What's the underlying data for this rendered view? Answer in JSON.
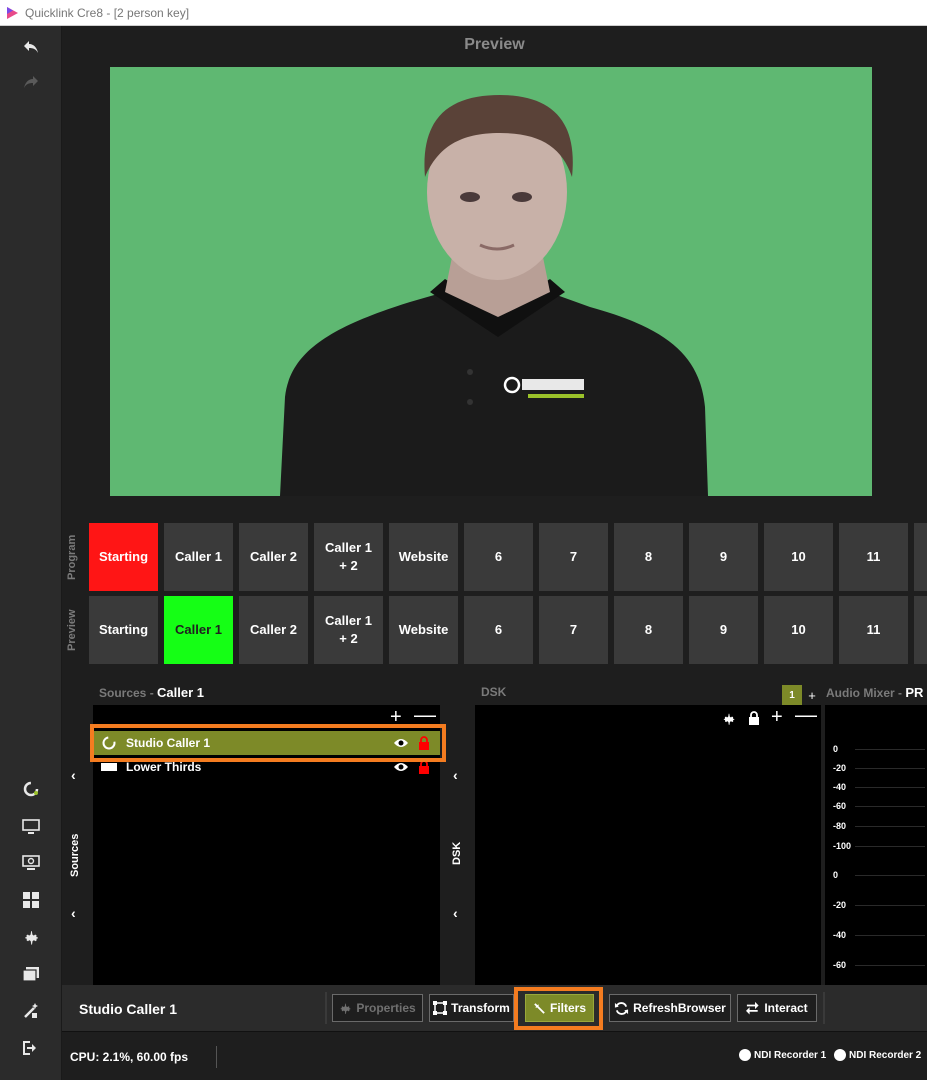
{
  "window": {
    "title": "Quicklink Cre8  - [2 person key]"
  },
  "leftbar": {
    "top_icons": [
      "undo-icon",
      "redo-icon"
    ],
    "bottom_icons": [
      "quicklink-logo-icon",
      "monitor-icon",
      "screen-share-icon",
      "layout-grid-icon",
      "gear-icon",
      "files-icon",
      "magic-tools-icon",
      "logout-icon"
    ]
  },
  "preview": {
    "title": "Preview"
  },
  "switcher": {
    "program_label": "Program",
    "preview_label": "Preview",
    "program": [
      {
        "label": "Starting",
        "state": "live"
      },
      {
        "label": "Caller 1"
      },
      {
        "label": "Caller 2"
      },
      {
        "label": "Caller 1\n+ 2"
      },
      {
        "label": "Website"
      },
      {
        "label": "6"
      },
      {
        "label": "7"
      },
      {
        "label": "8"
      },
      {
        "label": "9"
      },
      {
        "label": "10"
      },
      {
        "label": "11"
      }
    ],
    "preview": [
      {
        "label": "Starting"
      },
      {
        "label": "Caller 1",
        "state": "preview"
      },
      {
        "label": "Caller 2"
      },
      {
        "label": "Caller 1\n+ 2"
      },
      {
        "label": "Website"
      },
      {
        "label": "6"
      },
      {
        "label": "7"
      },
      {
        "label": "8"
      },
      {
        "label": "9"
      },
      {
        "label": "10"
      },
      {
        "label": "11"
      }
    ]
  },
  "sources": {
    "header_label": "Sources",
    "header_sep": "-",
    "header_scene": "Caller 1",
    "strip_label": "Sources",
    "items": [
      {
        "label": "Studio Caller 1",
        "selected": true
      },
      {
        "label": "Lower Thirds",
        "selected": false
      }
    ]
  },
  "dsk": {
    "header_label": "DSK",
    "strip_label": "DSK",
    "layer_badge": "1",
    "add_label": "+"
  },
  "audio_mixer": {
    "header_label": "Audio Mixer",
    "header_sep": "-",
    "header_value": "PR",
    "scale": [
      "0",
      "-20",
      "-40",
      "-60",
      "-80",
      "-100",
      "0",
      "-20",
      "-40",
      "-60"
    ]
  },
  "toolbar": {
    "selected_source": "Studio Caller 1",
    "buttons": {
      "properties": "Properties",
      "transform": "Transform",
      "filters": "Filters",
      "refresh": "RefreshBrowser",
      "interact": "Interact"
    }
  },
  "status": {
    "cpu": "CPU: 2.1%, 60.00 fps",
    "recorder1": "NDI Recorder 1",
    "recorder2": "NDI Recorder 2"
  },
  "colors": {
    "accent": "#7d8a28",
    "program_live": "#ff1515",
    "preview_ready": "#15ff15",
    "highlight": "#f47c20",
    "lock": "#ff0000"
  }
}
